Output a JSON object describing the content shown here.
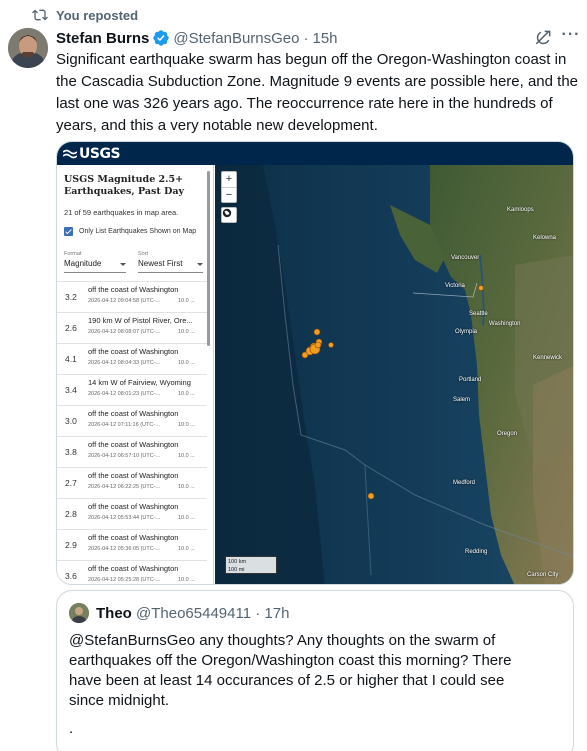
{
  "repost": {
    "label": "You reposted",
    "icon": "repost-icon"
  },
  "tweet": {
    "author_name": "Stefan Burns",
    "handle": "@StefanBurnsGeo",
    "separator": "·",
    "time": "15h",
    "text": "Significant earthquake swarm has begun off the Oregon-Washington coast in the Cascadia Subduction Zone. Magnitude 9 events are possible here, and the last one was 326 years ago. The reoccurrence rate here in the hundreds of years, and this a very notable new development."
  },
  "usgs": {
    "logo": "USGS",
    "title_line1": "USGS Magnitude 2.5+",
    "title_line2": "Earthquakes, Past Day",
    "count": "21 of 59 earthquakes in map area.",
    "checkbox_label": "Only List Earthquakes Shown on Map",
    "format_caption": "Format",
    "format_value": "Magnitude",
    "sort_caption": "Sort",
    "sort_value": "Newest First",
    "earthquakes": [
      {
        "mag": "3.2",
        "place": "off the coast of Washington",
        "time": "2026-04-12 09:04:58 (UTC-...",
        "depth": "10.0 ..."
      },
      {
        "mag": "2.6",
        "place": "190 km W of Pistol River, Ore...",
        "time": "2026-04-12 08:08:07 (UTC-...",
        "depth": "10.0 ..."
      },
      {
        "mag": "4.1",
        "place": "off the coast of Washington",
        "time": "2026-04-12 08:04:33 (UTC-...",
        "depth": "10.0 ..."
      },
      {
        "mag": "3.4",
        "place": "14 km W of Fairview, Wyoming",
        "time": "2026-04-12 08:01:23 (UTC-...",
        "depth": "10.0 ..."
      },
      {
        "mag": "3.0",
        "place": "off the coast of Washington",
        "time": "2026-04-12 07:11:16 (UTC-...",
        "depth": "10.0 ..."
      },
      {
        "mag": "3.8",
        "place": "off the coast of Washington",
        "time": "2026-04-12 06:57:10 (UTC-...",
        "depth": "10.0 ..."
      },
      {
        "mag": "2.7",
        "place": "off the coast of Washington",
        "time": "2026-04-12 06:22:25 (UTC-...",
        "depth": "10.0 ..."
      },
      {
        "mag": "2.8",
        "place": "off the coast of Washington",
        "time": "2026-04-12 05:53:44 (UTC-...",
        "depth": "10.0 ..."
      },
      {
        "mag": "2.9",
        "place": "off the coast of Washington",
        "time": "2026-04-12 05:36:05 (UTC-...",
        "depth": "10.0 ..."
      },
      {
        "mag": "3.6",
        "place": "off the coast of Washington",
        "time": "2026-04-12 05:25:28 (UTC-...",
        "depth": "10.0 ..."
      }
    ],
    "map_labels": {
      "kamloops": "Kamloops",
      "kelowna": "Kelowna",
      "vancouver": "Vancouver",
      "victoria": "Victoria",
      "seattle": "Seattle",
      "washington": "Washington",
      "olympia": "Olympia",
      "kennewick": "Kennewick",
      "portland": "Portland",
      "salem": "Salem",
      "oregon": "Oregon",
      "medford": "Medford",
      "redding": "Redding",
      "carson_city": "Carson City"
    },
    "zoom_in": "+",
    "zoom_out": "−",
    "scale_km": "100 km",
    "scale_mi": "100 mi",
    "accent_color": "#00264c",
    "marker_color": "#f39c22"
  },
  "quote": {
    "author_name": "Theo",
    "handle": "@Theo65449411",
    "separator": "·",
    "time": "17h",
    "text": "@StefanBurnsGeo any thoughts? Any thoughts on the swarm of earthquakes off the Oregon/Washington coast this morning? There have been at least 14 occurances of 2.5 or higher that I could see since midnight.",
    "trailing": "."
  }
}
